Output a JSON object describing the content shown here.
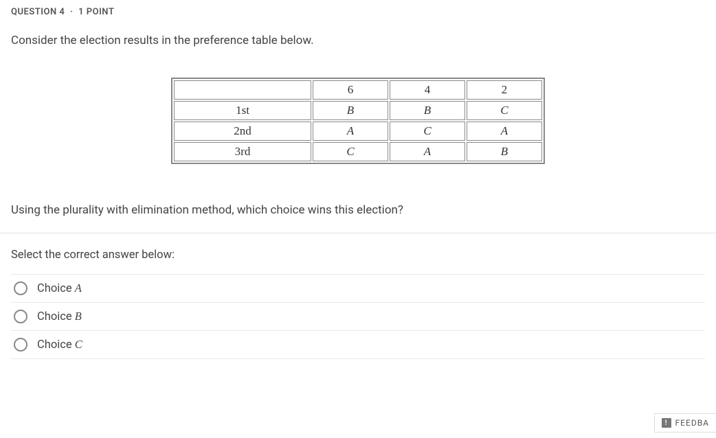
{
  "header": {
    "question_label": "QUESTION 4",
    "separator": "·",
    "points": "1 POINT"
  },
  "prompt1": "Consider the election results in the preference table below.",
  "table": {
    "header_row": [
      "",
      "6",
      "4",
      "2"
    ],
    "rows": [
      {
        "rank": "1st",
        "c1": "B",
        "c2": "B",
        "c3": "C"
      },
      {
        "rank": "2nd",
        "c1": "A",
        "c2": "C",
        "c3": "A"
      },
      {
        "rank": "3rd",
        "c1": "C",
        "c2": "A",
        "c3": "B"
      }
    ]
  },
  "prompt2": "Using the plurality with elimination method, which choice wins this election?",
  "select_prompt": "Select the correct answer below:",
  "options": [
    {
      "prefix": "Choice ",
      "letter": "A"
    },
    {
      "prefix": "Choice ",
      "letter": "B"
    },
    {
      "prefix": "Choice ",
      "letter": "C"
    }
  ],
  "feedback": {
    "icon_char": "!",
    "label": "FEEDBA"
  }
}
